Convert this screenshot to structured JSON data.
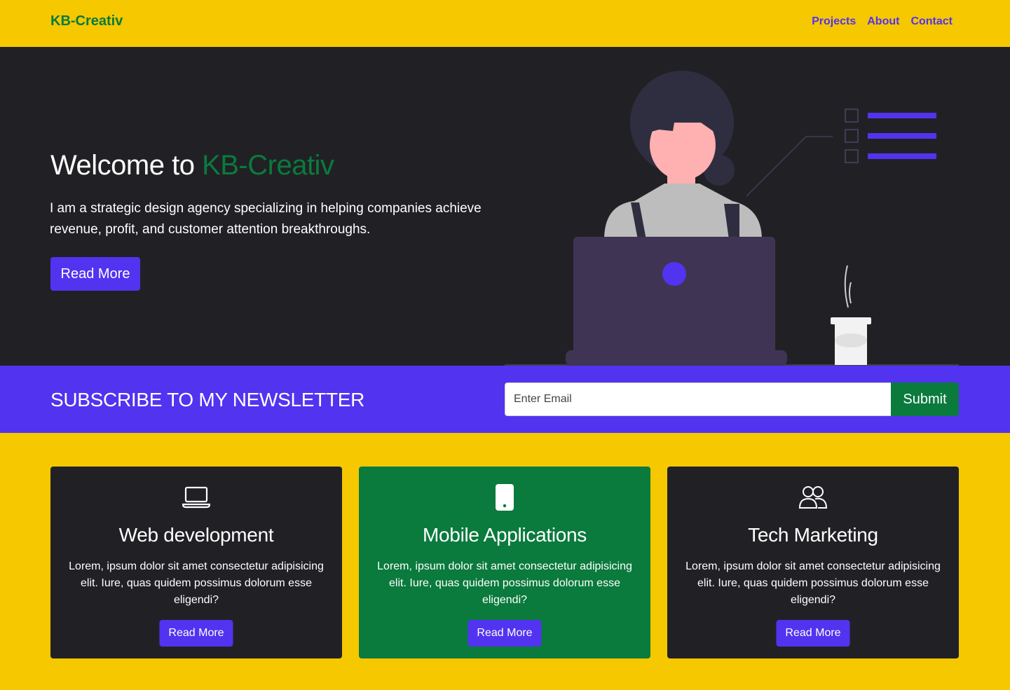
{
  "navbar": {
    "brand": "KB-Creativ",
    "links": [
      {
        "label": "Projects"
      },
      {
        "label": "About"
      },
      {
        "label": "Contact"
      }
    ]
  },
  "hero": {
    "title_prefix": "Welcome to ",
    "title_accent": "KB-Creativ",
    "text": "I am a strategic design agency specializing in helping companies achieve revenue, profit, and customer attention breakthroughs.",
    "button_label": "Read More",
    "illustration_icon": "woman-at-laptop-illustration"
  },
  "newsletter": {
    "title": "SUBSCRIBE TO MY NEWSLETTER",
    "email_placeholder": "Enter Email",
    "submit_label": "Submit"
  },
  "cards": [
    {
      "icon": "laptop-icon",
      "title": "Web development",
      "text": "Lorem, ipsum dolor sit amet consectetur adipisicing elit. Iure, quas quidem possimus dolorum esse eligendi?",
      "button_label": "Read More"
    },
    {
      "icon": "phone-icon",
      "title": "Mobile Applications",
      "text": "Lorem, ipsum dolor sit amet consectetur adipisicing elit. Iure, quas quidem possimus dolorum esse eligendi?",
      "button_label": "Read More"
    },
    {
      "icon": "people-icon",
      "title": "Tech Marketing",
      "text": "Lorem, ipsum dolor sit amet consectetur adipisicing elit. Iure, quas quidem possimus dolorum esse eligendi?",
      "button_label": "Read More"
    }
  ],
  "colors": {
    "yellow": "#f5c800",
    "dark": "#212125",
    "green": "#0a7a3d",
    "purple": "#5233f0"
  }
}
